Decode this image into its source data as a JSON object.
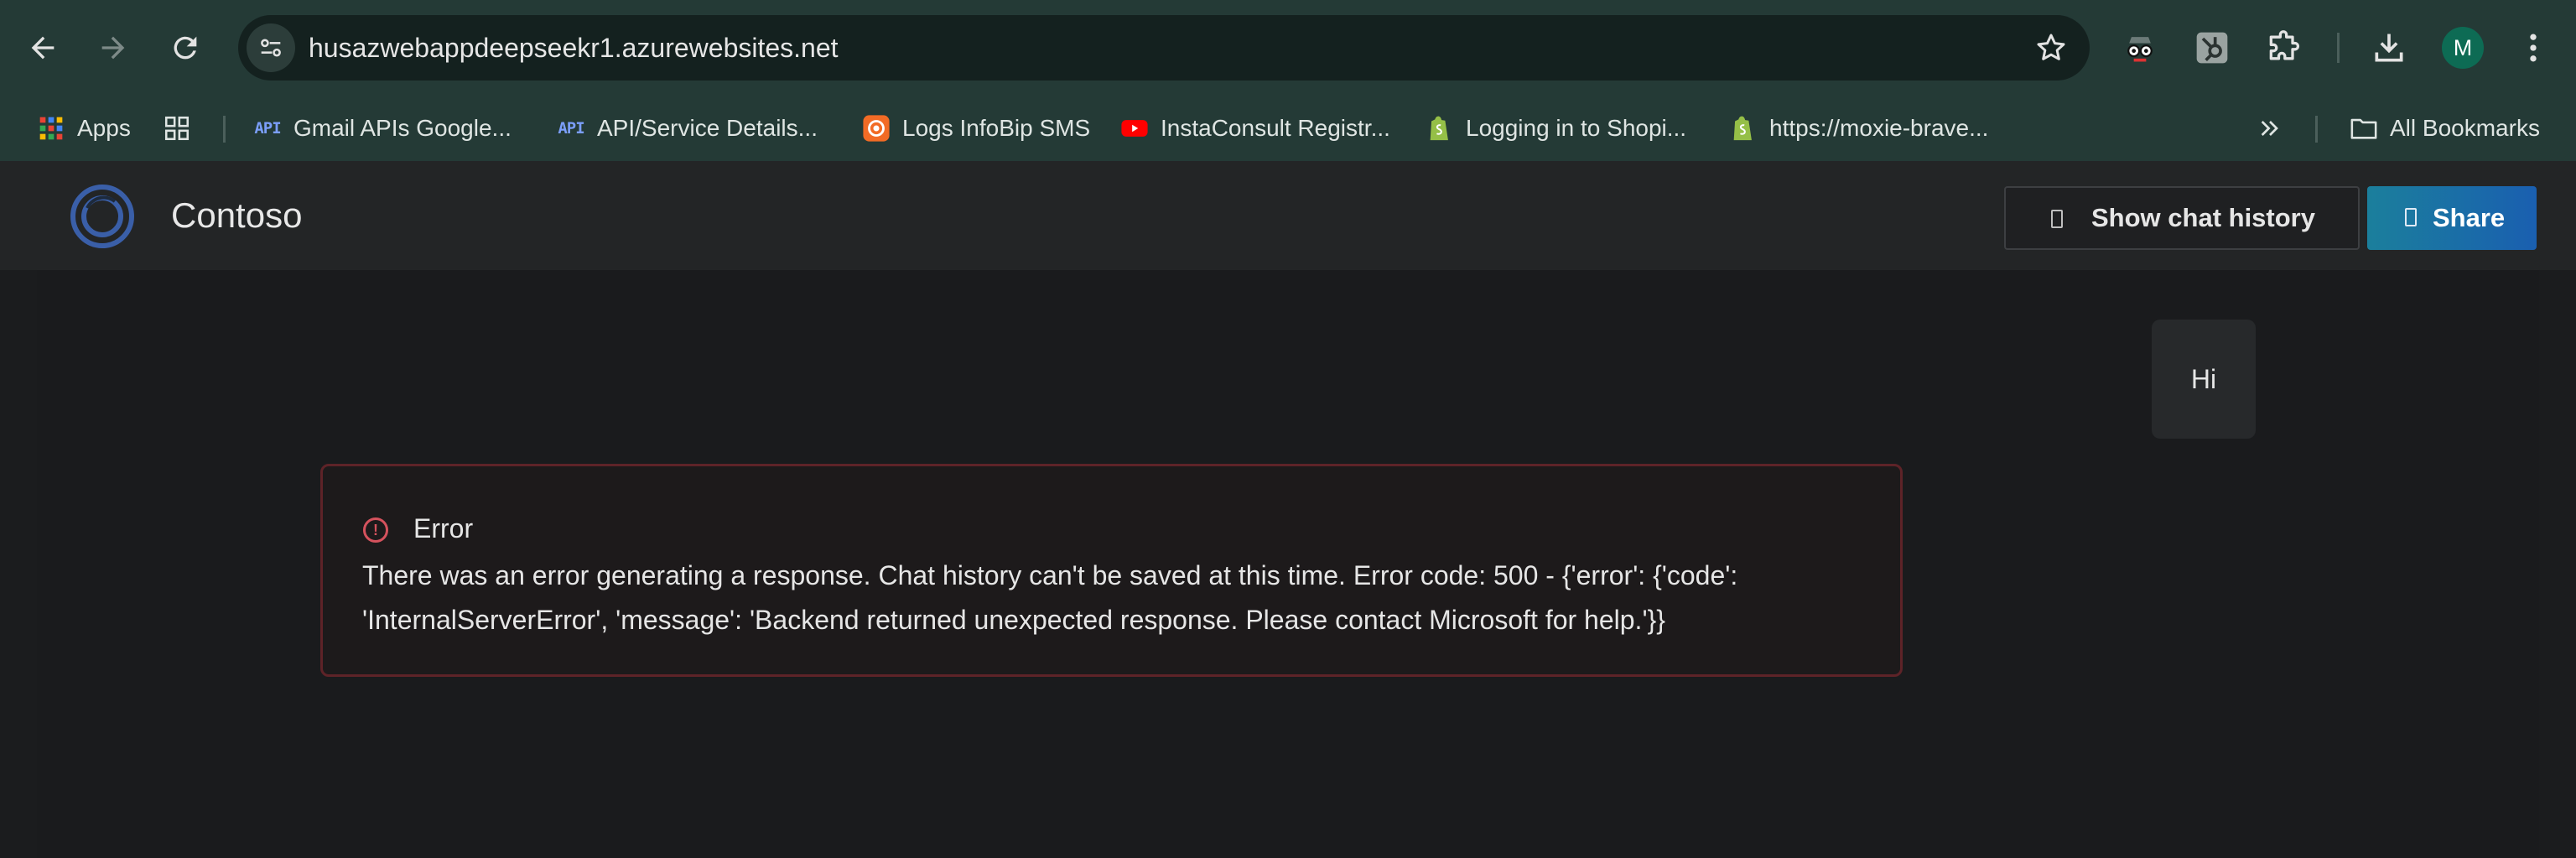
{
  "browser": {
    "url": "husazwebappdeepseekr1.azurewebsites.net",
    "profile_initial": "M",
    "icons": [
      "back-icon",
      "forward-icon",
      "reload-icon",
      "site-info-icon",
      "star-icon",
      "spy-extension-icon",
      "hubspot-icon",
      "puzzle-icon",
      "download-icon",
      "more-vert-icon"
    ]
  },
  "bookmarks": {
    "apps_label": "Apps",
    "items": [
      {
        "label": "Gmail APIs Google...",
        "favicon": "API"
      },
      {
        "label": "API/Service Details...",
        "favicon": "API"
      },
      {
        "label": "Logs InfoBip SMS",
        "favicon": "infobip-icon"
      },
      {
        "label": "InstaConsult Registr...",
        "favicon": "youtube-icon"
      },
      {
        "label": "Logging in to Shopi...",
        "favicon": "shopify-icon"
      },
      {
        "label": "https://moxie-brave...",
        "favicon": "shopify-icon"
      }
    ],
    "all_bookmarks_label": "All Bookmarks"
  },
  "app": {
    "title": "Contoso",
    "show_history_label": "Show chat history",
    "share_label": "Share"
  },
  "chat": {
    "user_message": "Hi",
    "error": {
      "title": "Error",
      "message": "There was an error generating a response. Chat history can't be saved at this time. Error code: 500 - {'error': {'code': 'InternalServerError', 'message': 'Backend returned unexpected response. Please contact Microsoft for help.'}}"
    }
  },
  "colors": {
    "chrome_bg": "#243a36",
    "omnibox_bg": "#14211f",
    "app_header_bg": "#232526",
    "page_bg": "#1a1b1d",
    "share_gradient": [
      "#1b7f9c",
      "#1a5fb0"
    ],
    "error_border": "#5e2328",
    "error_icon": "#d5525d"
  }
}
